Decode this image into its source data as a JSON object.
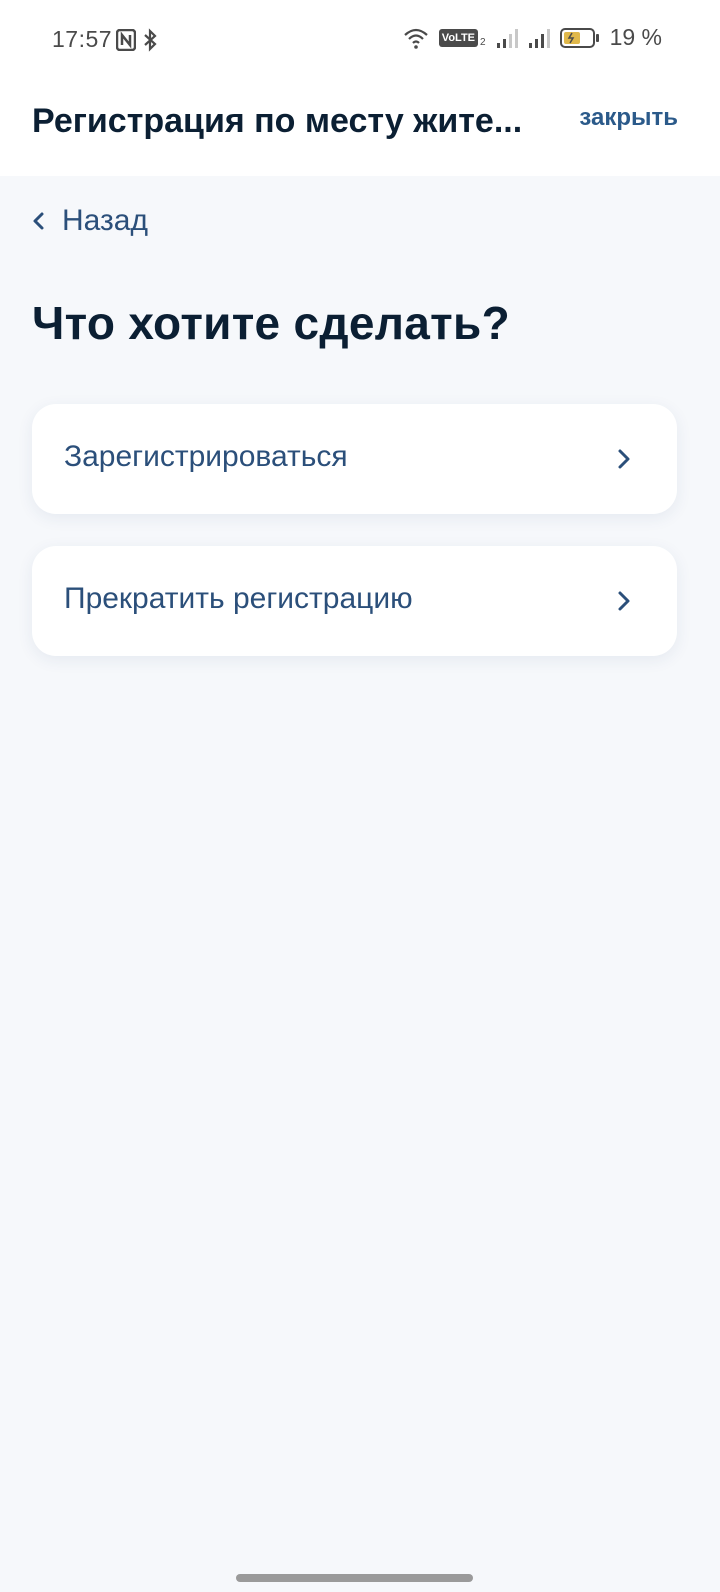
{
  "status_bar": {
    "time": "17:57",
    "network_badge": "VoLTE",
    "network_sub": "2",
    "battery": "19 %",
    "icons": [
      "nfc-icon",
      "bluetooth-icon",
      "wifi-icon",
      "signal-icon",
      "signal-icon",
      "battery-icon"
    ]
  },
  "header": {
    "title": "Регистрация по месту жите...",
    "close_label": "закрыть"
  },
  "back": {
    "label": "Назад"
  },
  "main": {
    "question": "Что хотите сделать?",
    "options": [
      {
        "label": "Зарегистрироваться"
      },
      {
        "label": "Прекратить регистрацию"
      }
    ]
  },
  "colors": {
    "background": "#f6f8fb",
    "card": "#ffffff",
    "link": "#2b4f7a",
    "text": "#0b1f33"
  }
}
